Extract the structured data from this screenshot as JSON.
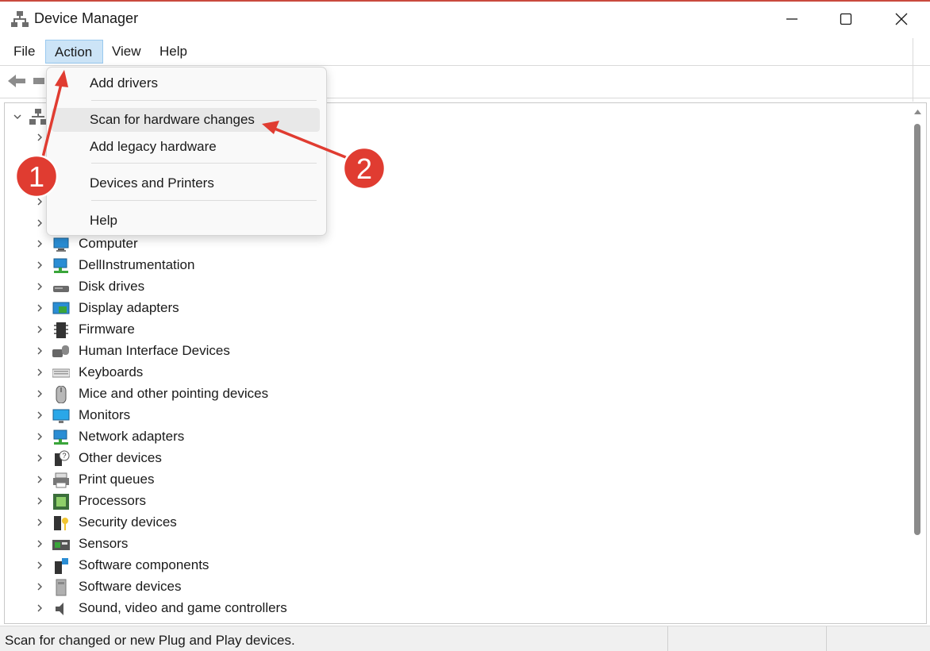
{
  "window": {
    "title": "Device Manager"
  },
  "menubar": {
    "items": [
      {
        "label": "File"
      },
      {
        "label": "Action"
      },
      {
        "label": "View"
      },
      {
        "label": "Help"
      }
    ]
  },
  "action_menu": {
    "items": [
      {
        "label": "Add drivers"
      },
      {
        "label": "Scan for hardware changes"
      },
      {
        "label": "Add legacy hardware"
      },
      {
        "label": "Devices and Printers"
      },
      {
        "label": "Help"
      }
    ]
  },
  "tree": {
    "items": [
      {
        "label": "Computer",
        "icon": "computer-icon"
      },
      {
        "label": "DellInstrumentation",
        "icon": "network-icon"
      },
      {
        "label": "Disk drives",
        "icon": "disk-drive-icon"
      },
      {
        "label": "Display adapters",
        "icon": "display-adapter-icon"
      },
      {
        "label": "Firmware",
        "icon": "firmware-chip-icon"
      },
      {
        "label": "Human Interface Devices",
        "icon": "hid-icon"
      },
      {
        "label": "Keyboards",
        "icon": "keyboard-icon"
      },
      {
        "label": "Mice and other pointing devices",
        "icon": "mouse-icon"
      },
      {
        "label": "Monitors",
        "icon": "monitor-icon"
      },
      {
        "label": "Network adapters",
        "icon": "network-icon"
      },
      {
        "label": "Other devices",
        "icon": "unknown-device-icon"
      },
      {
        "label": "Print queues",
        "icon": "printer-icon"
      },
      {
        "label": "Processors",
        "icon": "processor-icon"
      },
      {
        "label": "Security devices",
        "icon": "security-device-icon"
      },
      {
        "label": "Sensors",
        "icon": "sensor-icon"
      },
      {
        "label": "Software components",
        "icon": "software-component-icon"
      },
      {
        "label": "Software devices",
        "icon": "software-device-icon"
      },
      {
        "label": "Sound, video and game controllers",
        "icon": "speaker-icon"
      }
    ]
  },
  "statusbar": {
    "text": "Scan for changed or new Plug and Play devices."
  },
  "annotations": {
    "badge1": "1",
    "badge2": "2",
    "color": "#e03c31"
  }
}
